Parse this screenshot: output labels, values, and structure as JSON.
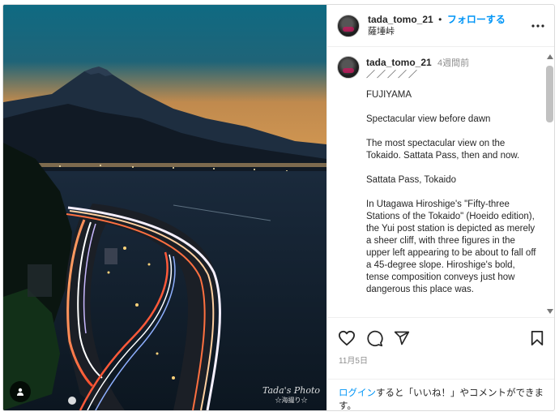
{
  "post": {
    "username": "tada_tomo_21",
    "follow_label": "フォローする",
    "location": "薩埵峠",
    "more_label": "•••",
    "watermark": "Tada's Photo",
    "watermark_sub": "☆海撮り☆"
  },
  "caption": {
    "username": "tada_tomo_21",
    "time": "4週間前",
    "slashes": "／／／／／",
    "text": "FUJIYAMA\n\nSpectacular view before dawn\n\nThe most spectacular view on the Tokaido. Sattata Pass, then and now.\n\nSattata Pass, Tokaido\n\nIn Utagawa Hiroshige's \"Fifty-three Stations of the Tokaido\" (Hoeido edition), the Yui post station is depicted as merely a sheer cliff, with three figures in the upper left appearing to be about to fall off a 45-degree slope. Hiroshige's bold, tense composition conveys just how dangerous this place was."
  },
  "actions": {
    "icons": [
      "heart-icon",
      "comment-icon",
      "share-icon",
      "bookmark-icon"
    ],
    "date": "11月5日"
  },
  "login": {
    "link": "ログイン",
    "text": "すると「いいね！」やコメントができます。"
  },
  "colors": {
    "accent": "#0095f6",
    "text": "#262626",
    "muted": "#8e8e8e"
  }
}
